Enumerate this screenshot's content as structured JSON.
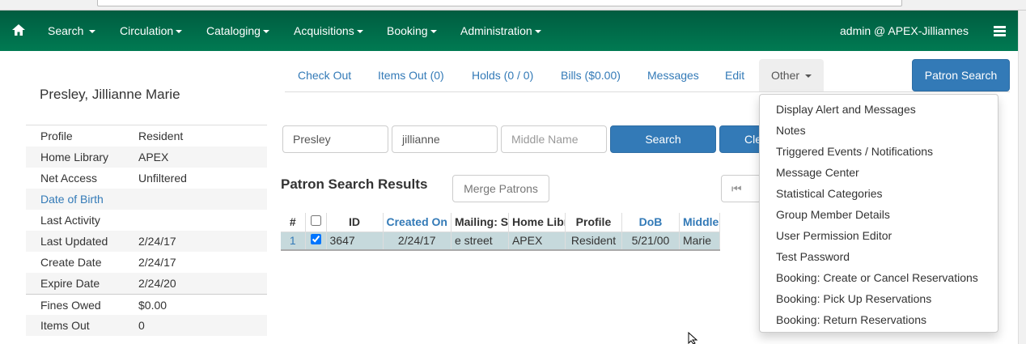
{
  "nav": {
    "items": [
      "Search",
      "Circulation",
      "Cataloging",
      "Acquisitions",
      "Booking",
      "Administration"
    ],
    "user": "admin @ APEX-Jilliannes"
  },
  "patron": {
    "name": "Presley, Jillianne Marie",
    "summary": [
      {
        "k": "Profile",
        "v": "Resident"
      },
      {
        "k": "Home Library",
        "v": "APEX"
      },
      {
        "k": "Net Access",
        "v": "Unfiltered"
      },
      {
        "k": "Date of Birth",
        "v": ""
      },
      {
        "k": "Last Activity",
        "v": ""
      },
      {
        "k": "Last Updated",
        "v": "2/24/17"
      },
      {
        "k": "Create Date",
        "v": "2/24/17"
      },
      {
        "k": "Expire Date",
        "v": "2/24/20"
      },
      {
        "k": "Fines Owed",
        "v": "$0.00"
      },
      {
        "k": "Items Out",
        "v": "0"
      }
    ]
  },
  "tabs": [
    "Check Out",
    "Items Out (0)",
    "Holds (0 / 0)",
    "Bills ($0.00)",
    "Messages",
    "Edit",
    "Other"
  ],
  "patron_search_button": "Patron Search",
  "search": {
    "last": "Presley",
    "first": "jillianne",
    "middle_placeholder": "Middle Name",
    "search_label": "Search",
    "clear_label": "Cle"
  },
  "results": {
    "title": "Patron Search Results",
    "merge_label": "Merge Patrons",
    "columns": [
      "#",
      "",
      "ID",
      "Created On",
      "Mailing: Stre",
      "Home Librar",
      "Profile",
      "DoB",
      "Middle"
    ],
    "rows": [
      [
        "1",
        "",
        "3647",
        "2/24/17",
        "e street",
        "APEX",
        "Resident",
        "5/21/00",
        "Marie"
      ]
    ]
  },
  "other_menu": [
    "Display Alert and Messages",
    "Notes",
    "Triggered Events / Notifications",
    "Message Center",
    "Statistical Categories",
    "Group Member Details",
    "User Permission Editor",
    "Test Password",
    "Booking: Create or Cancel Reservations",
    "Booking: Pick Up Reservations",
    "Booking: Return Reservations"
  ],
  "colors": {
    "nav": "#006e4e",
    "primary": "#337ab7",
    "link": "#337ab7"
  }
}
